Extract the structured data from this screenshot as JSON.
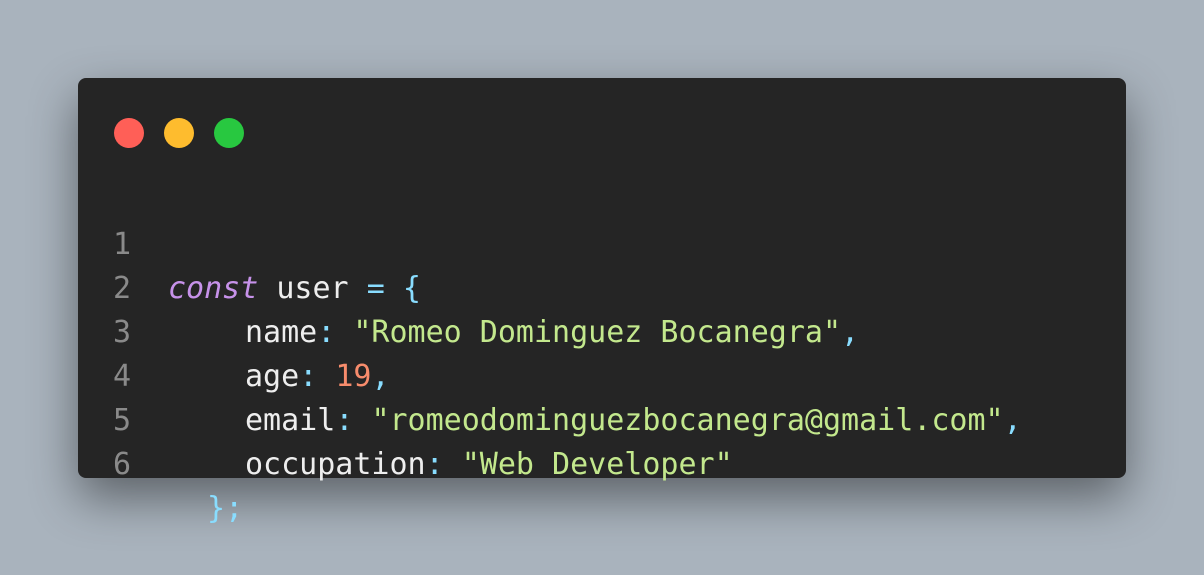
{
  "colors": {
    "background": "#a9b3bd",
    "window": "#252525",
    "close_dot": "#ff5f57",
    "minimize_dot": "#febc2e",
    "maximize_dot": "#28c840",
    "line_number": "#8a8a8a",
    "keyword": "#c792ea",
    "identifier": "#eeeeee",
    "punctuation": "#89ddff",
    "string": "#c3e88d",
    "number": "#f78c6c"
  },
  "window_controls": [
    "close-dot",
    "minimize-dot",
    "maximize-dot"
  ],
  "code": {
    "lines": [
      {
        "num": "1",
        "keyword": "const",
        "name": "user",
        "op": "=",
        "brace": "{"
      },
      {
        "num": "2",
        "key": "name",
        "colon": ":",
        "value": "\"Romeo Dominguez Bocanegra\"",
        "comma": ","
      },
      {
        "num": "3",
        "key": "age",
        "colon": ":",
        "value": "19",
        "comma": ","
      },
      {
        "num": "4",
        "key": "email",
        "colon": ":",
        "value": "\"romeodominguezbocanegra@gmail.com\"",
        "comma": ","
      },
      {
        "num": "5",
        "key": "occupation",
        "colon": ":",
        "value": "\"Web Developer\""
      },
      {
        "num": "6",
        "close": "}",
        "semicolon": ";"
      }
    ]
  }
}
